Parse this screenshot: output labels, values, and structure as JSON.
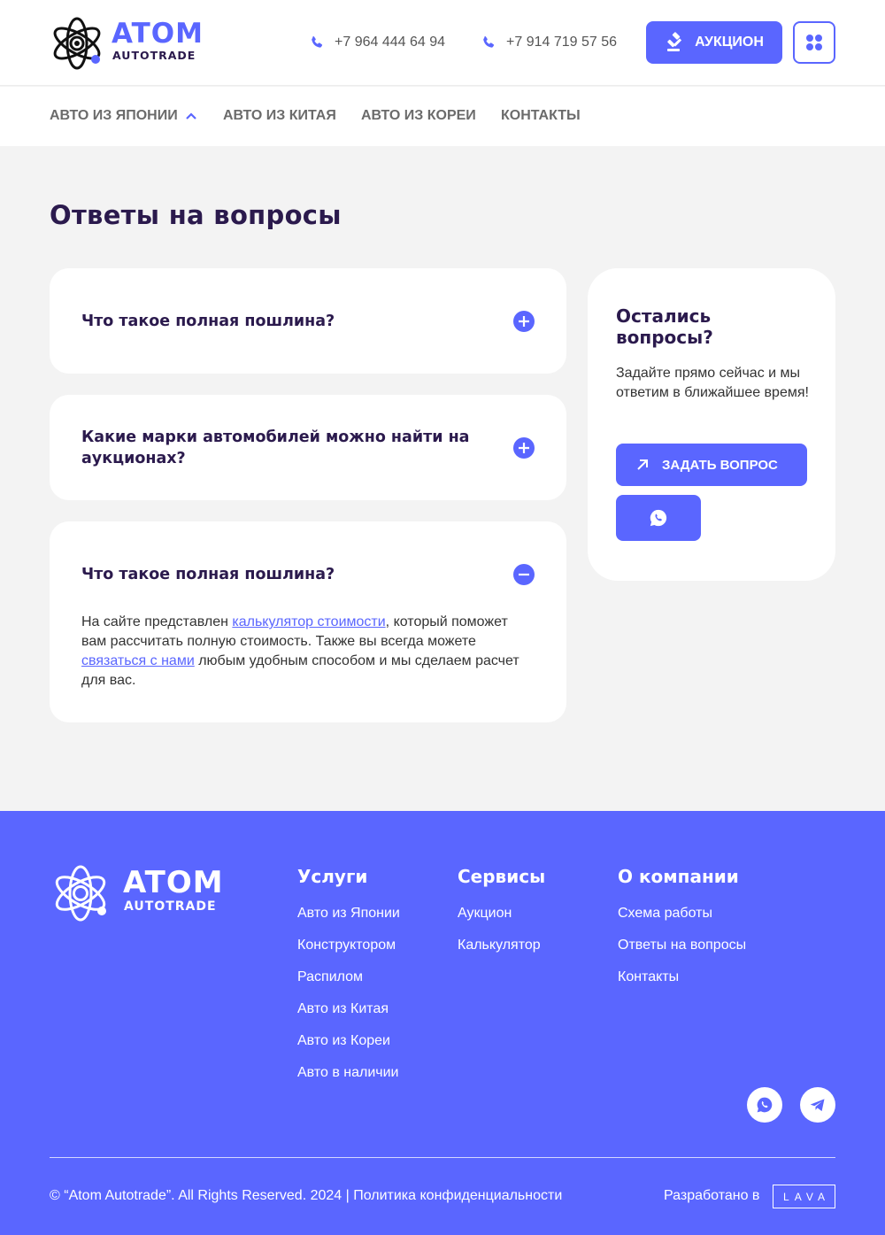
{
  "colors": {
    "accent": "#5a66ff",
    "dark": "#2b1a4d",
    "bg": "#f3f3f3"
  },
  "header": {
    "logo_word": "ATOM",
    "logo_sub": "AUTOTRADE",
    "phones": [
      "+7 964 444 64 94",
      "+7 914 719 57 56"
    ],
    "auction_label": "АУКЦИОН",
    "icons": {
      "phone": "phone-icon",
      "auction": "gavel-icon",
      "menu": "grid-dots-icon"
    }
  },
  "nav": {
    "items": [
      "АВТО ИЗ ЯПОНИИ",
      "АВТО ИЗ КИТАЯ",
      "АВТО ИЗ КОРЕИ",
      "КОНТАКТЫ"
    ]
  },
  "main": {
    "title": "Ответы на вопросы",
    "faq": [
      {
        "question": "Что такое полная пошлина?",
        "expanded": false
      },
      {
        "question": "Какие марки автомобилей можно найти на аукционах?",
        "expanded": false
      },
      {
        "question": "Что такое полная пошлина?",
        "expanded": true,
        "answer": {
          "part1": "На сайте представлен ",
          "link1": "калькулятор стоимости",
          "part2": ", который поможет вам рассчитать полную стоимость. Также вы всегда можете ",
          "link2": "связаться с нами",
          "part3": " любым удобным способом и мы сделаем расчет для вас."
        }
      }
    ],
    "side": {
      "title": "Остались вопросы?",
      "text": "Задайте прямо сейчас и мы ответим в ближайшее время!",
      "ask_label": "ЗАДАТЬ ВОПРОС"
    }
  },
  "footer": {
    "logo_word": "ATOM",
    "logo_sub": "AUTOTRADE",
    "columns": [
      {
        "title": "Услуги",
        "links": [
          "Авто из Японии",
          "Конструктором",
          "Распилом",
          "Авто из Китая",
          "Авто из Кореи",
          "Авто в наличии"
        ]
      },
      {
        "title": "Сервисы",
        "links": [
          "Аукцион",
          "Калькулятор"
        ]
      },
      {
        "title": "О компании",
        "links": [
          "Схема работы",
          "Ответы на вопросы",
          "Контакты"
        ]
      }
    ],
    "copyright": "©  “Atom Autotrade”. All Rights Reserved. 2024 | Политика конфиденциальности",
    "developed_by": "Разработано в",
    "dev_logo": "LAVA"
  }
}
